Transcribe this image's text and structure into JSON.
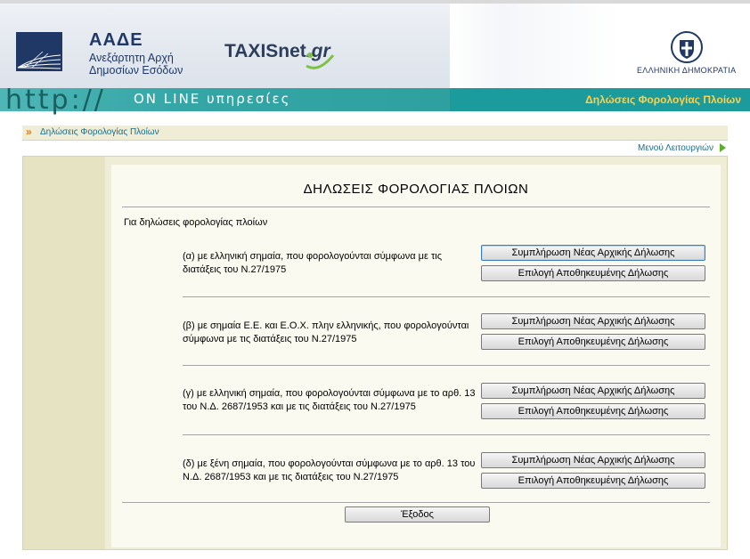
{
  "header": {
    "org_acronym": "ΑΑΔΕ",
    "org_name": "Ανεξάρτητη Αρχή Δημοσίων Εσόδων",
    "portal_name": "TAXISnet",
    "portal_suffix": ".gr",
    "gov_text": "ΕΛΛΗΝΙΚΗ ΔΗΜΟΚΡΑΤΙΑ"
  },
  "banner": {
    "http_text": "http://",
    "online_text": "ON LINE υπηρεσίες",
    "section_title": "Δηλώσεις Φορολογίας Πλοίων"
  },
  "breadcrumb": {
    "label": "Δηλώσεις Φορολογίας Πλοίων"
  },
  "menu_link": "Μενού Λειτουργιών",
  "main": {
    "title": "ΔΗΛΩΣΕΙΣ ΦΟΡΟΛΟΓΙΑΣ ΠΛΟΙΩΝ",
    "intro": "Για δηλώσεις φορολογίας πλοίων",
    "categories": [
      {
        "text": "(α) με ελληνική σημαία, που φορολογούνται σύμφωνα με τις διατάξεις του Ν.27/1975",
        "new_label": "Συμπλήρωση Νέας Αρχικής Δήλωσης",
        "saved_label": "Επιλογή Αποθηκευμένης Δήλωσης"
      },
      {
        "text": "(β) με σημαία Ε.Ε. και Ε.Ο.Χ. πλην ελληνικής, που φορολογούνται σύμφωνα με τις διατάξεις του Ν.27/1975",
        "new_label": "Συμπλήρωση Νέας Αρχικής Δήλωσης",
        "saved_label": "Επιλογή Αποθηκευμένης Δήλωσης"
      },
      {
        "text": "(γ) με ελληνική σημαία, που φορολογούνται σύμφωνα με το αρθ. 13 του Ν.Δ. 2687/1953 και με τις διατάξεις του Ν.27/1975",
        "new_label": "Συμπλήρωση Νέας Αρχικής Δήλωσης",
        "saved_label": "Επιλογή Αποθηκευμένης Δήλωσης"
      },
      {
        "text": "(δ) με ξένη σημαία, που φορολογούνται σύμφωνα με το αρθ. 13 του Ν.Δ. 2687/1953 και με τις διατάξεις του Ν.27/1975",
        "new_label": "Συμπλήρωση Νέας Αρχικής Δήλωσης",
        "saved_label": "Επιλογή Αποθηκευμένης Δήλωσης"
      }
    ],
    "exit_label": "Έξοδος"
  },
  "colors": {
    "teal_bar": "#1b9b9b",
    "banner_title": "#ffd04d",
    "brand_navy": "#1f3866",
    "link": "#1a6c8c",
    "panel_bg": "#efedd6"
  },
  "icons": [
    "aade-logo-icon",
    "greek-emblem-icon",
    "breadcrumb-arrow-icon",
    "menu-arrow-icon"
  ]
}
